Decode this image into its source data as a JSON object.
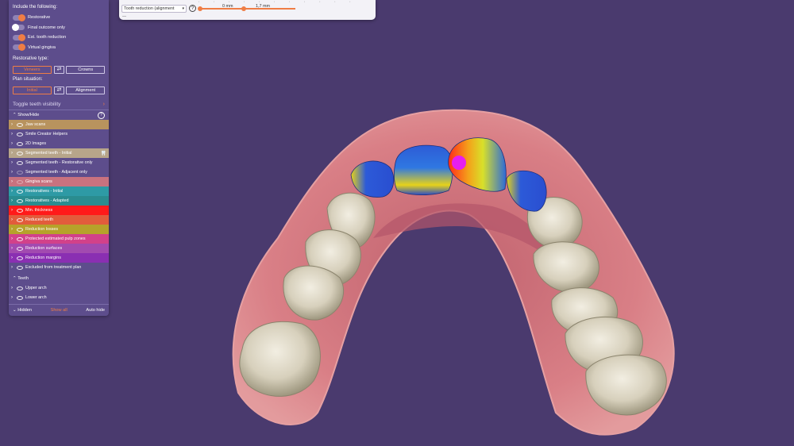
{
  "panel": {
    "include_title": "Include the following:",
    "toggles": [
      {
        "label": "Restorative",
        "on": true
      },
      {
        "label": "Final outcome only",
        "on": false
      },
      {
        "label": "Est. tooth reduction",
        "on": true
      },
      {
        "label": "Virtual gingiva",
        "on": true
      }
    ],
    "restorative_type_title": "Restorative type:",
    "restorative_type": {
      "active": "Veneers",
      "inactive": "Crowns"
    },
    "plan_situation_title": "Plan situation:",
    "plan_situation": {
      "active": "Initial",
      "inactive": "Alignment"
    },
    "toggle_visibility": "Toggle teeth visibility",
    "show_hide": "Show/Hide",
    "layers": [
      {
        "label": "Jaw scans",
        "color": "#b8935e",
        "eye": true
      },
      {
        "label": "Smile Creator Helpers",
        "color": "",
        "eye": true
      },
      {
        "label": "2D Images",
        "color": "",
        "eye": true
      },
      {
        "label": "Segmented teeth - Initial",
        "color": "#b7a58a",
        "eye": true
      },
      {
        "label": "Segmented teeth - Restorative only",
        "color": "",
        "eye": true
      },
      {
        "label": "Segmented teeth - Adjacent only",
        "color": "",
        "eye": false
      },
      {
        "label": "Gingiva scans",
        "color": "#c9727f",
        "eye": false
      },
      {
        "label": "Restoratives - Initial",
        "color": "#2e9aa5",
        "eye": true
      },
      {
        "label": "Restoratives - Adapted",
        "color": "#2a8c8f",
        "eye": true
      },
      {
        "label": "Min. thickness",
        "color": "#ff1a1a",
        "eye": true
      },
      {
        "label": "Reduced teeth",
        "color": "#e25c3c",
        "eye": true
      },
      {
        "label": "Reduction losses",
        "color": "#b6a22a",
        "eye": true
      },
      {
        "label": "Protected estimated pulp zones",
        "color": "#d2418a",
        "eye": true
      },
      {
        "label": "Reduction surfaces",
        "color": "#a24ab0",
        "eye": true
      },
      {
        "label": "Reduction margins",
        "color": "#8a2fb2",
        "eye": true
      },
      {
        "label": "Excluded from treatment plan",
        "color": "",
        "eye": true
      }
    ],
    "teeth_title": "Teeth",
    "teeth_items": [
      "Upper arch",
      "Lower arch"
    ],
    "footer": {
      "hidden": "Hidden",
      "show_all": "Show all",
      "auto_hide": "Auto hide"
    }
  },
  "toolbar": {
    "mode": "Tooth reduction (alignment",
    "help": "?",
    "min_value": "0 mm",
    "max_value": "1,7 mm"
  },
  "colors": {
    "background": "#4a3a6e",
    "panel": "#5d4d8c",
    "accent": "#ef7d45"
  }
}
